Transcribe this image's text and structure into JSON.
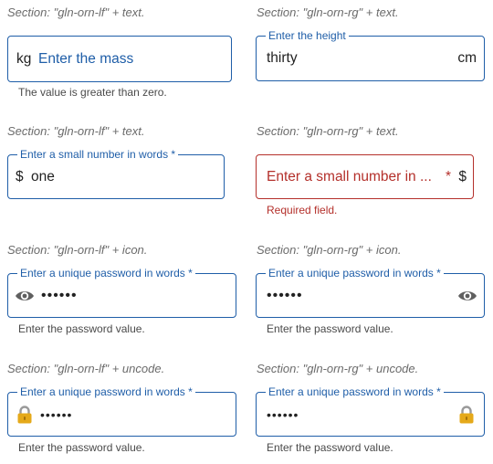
{
  "rows": [
    {
      "left": {
        "section": "Section: \"gln-orn-lf\" + text.",
        "prefix": "kg",
        "placeholder": "Enter the mass",
        "helper": "The value is greater than zero."
      },
      "right": {
        "section": "Section: \"gln-orn-rg\" + text.",
        "legend": "Enter the height",
        "value": "thirty",
        "suffix": "cm"
      }
    },
    {
      "left": {
        "section": "Section: \"gln-orn-lf\" + text.",
        "legend": "Enter a small number in words",
        "required_mark": "*",
        "prefix": "$",
        "value": "one"
      },
      "right": {
        "section": "Section: \"gln-orn-rg\" + text.",
        "placeholder": "Enter a small number in ...",
        "required_mark": "*",
        "suffix": "$",
        "helper": "Required field."
      }
    },
    {
      "left": {
        "section": "Section: \"gln-orn-lf\" + icon.",
        "legend": "Enter a unique password in words",
        "required_mark": "*",
        "icon": "eye-icon",
        "value": "••••••",
        "helper": "Enter the password value."
      },
      "right": {
        "section": "Section: \"gln-orn-rg\" + icon.",
        "legend": "Enter a unique password in words",
        "required_mark": "*",
        "icon": "eye-icon",
        "value": "••••••",
        "helper": "Enter the password value."
      }
    },
    {
      "left": {
        "section": "Section: \"gln-orn-lf\" + uncode.",
        "legend": "Enter a unique password in words",
        "required_mark": "*",
        "icon": "lock-icon",
        "value": "••••••",
        "helper": "Enter the password value."
      },
      "right": {
        "section": "Section: \"gln-orn-rg\" + uncode.",
        "legend": "Enter a unique password in words",
        "required_mark": "*",
        "icon": "lock-icon",
        "value": "••••••",
        "helper": "Enter the password value."
      }
    }
  ],
  "colors": {
    "accent": "#1f5ea8",
    "error": "#b4302b",
    "section_text": "#6b6b6b",
    "icon": "#5f5f5f",
    "lock_body": "#e5a91a"
  }
}
